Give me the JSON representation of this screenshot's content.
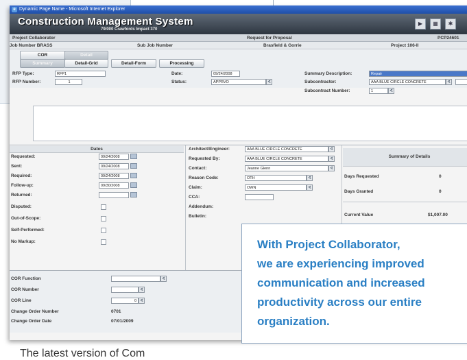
{
  "window": {
    "title": "Dynamic Page Name - Microsoft Internet Explorer"
  },
  "app": {
    "title": "Construction Management System",
    "subtitle": "79/000 Crawfords Impact 370"
  },
  "header_row": {
    "left": "Project Collaborator",
    "center": "Request for Proposal",
    "right": "PCP24601"
  },
  "job_row": {
    "job_number": "Job Number BRASS",
    "sub_job": "Sub Job Number",
    "company": "Brasfield & Gorrie",
    "project": "Project 106-II"
  },
  "tabs": {
    "cor": "COR",
    "disabled1": "Detail",
    "disabled2": "Summary",
    "detail_grid": "Detail-Grid",
    "detail_form": "Detail-Form",
    "processing": "Processing"
  },
  "form": {
    "rfp_type_label": "RFP Type:",
    "rfp_type_value": "RFP1",
    "rfp_number_label": "RFP Number:",
    "rfp_number_value": "1",
    "date_label": "Date:",
    "date_value": "09/24/2008",
    "status_label": "Status:",
    "status_value": "APPRVO",
    "summary_desc_label": "Summary Description:",
    "summary_desc_value": "Repair",
    "subcontractor_label": "Subcontractor:",
    "subcontractor_value": "AAA BLUE CIRCLE CONCRETE",
    "subcontract_number_label": "Subcontract Number:",
    "subcontract_number_value": "1"
  },
  "dates": {
    "title": "Dates",
    "rows": [
      {
        "label": "Requested:",
        "value": "09/24/2008"
      },
      {
        "label": "Sent:",
        "value": "09/24/2008"
      },
      {
        "label": "Required:",
        "value": "09/24/2008"
      },
      {
        "label": "Follow-up:",
        "value": "09/30/2008"
      },
      {
        "label": "Returned:",
        "value": ""
      }
    ],
    "checks": [
      "Disputed:",
      "Out-of-Scope:",
      "Self-Performed:",
      "No Markup:"
    ]
  },
  "contacts": {
    "rows": [
      {
        "label": "Architect/Engineer:",
        "value": "AAA BLUE CIRCLE CONCRETE"
      },
      {
        "label": "Requested By:",
        "value": "AAA BLUE CIRCLE CONCRETE"
      },
      {
        "label": "Contact:",
        "value": "Jeanne Glenn"
      },
      {
        "label": "Reason Code:",
        "value": "OTH"
      },
      {
        "label": "Claim:",
        "value": "OWN"
      },
      {
        "label": "CCA:",
        "value": ""
      },
      {
        "label": "Addendum:",
        "value": ""
      },
      {
        "label": "Bulletin:",
        "value": ""
      }
    ]
  },
  "summary": {
    "title": "Summary of Details",
    "days_requested_label": "Days Requested",
    "days_requested_value": "0",
    "days_granted_label": "Days Granted",
    "days_granted_value": "0",
    "current_value_label": "Current Value",
    "current_value_value": "$1,007.00"
  },
  "cor": {
    "function_label": "COR Function",
    "number_label": "COR Number",
    "line_label": "COR Line",
    "line_value": "0",
    "change_order_number_label": "Change Order Number",
    "change_order_number_value": "0701",
    "change_order_date_label": "Change Order Date",
    "change_order_date_value": "07/01/2009"
  },
  "quote": {
    "line1": "With Project Collaborator,",
    "line2": "we are experiencing improved",
    "line3": "communication and increased",
    "line4": "productivity across our entire",
    "line5": "organization."
  },
  "caption": "The latest version of Com",
  "colors": {
    "quote_text": "#2a7fc4",
    "titlebar": "#2a5bb8",
    "header_dark": "#3b444f"
  }
}
